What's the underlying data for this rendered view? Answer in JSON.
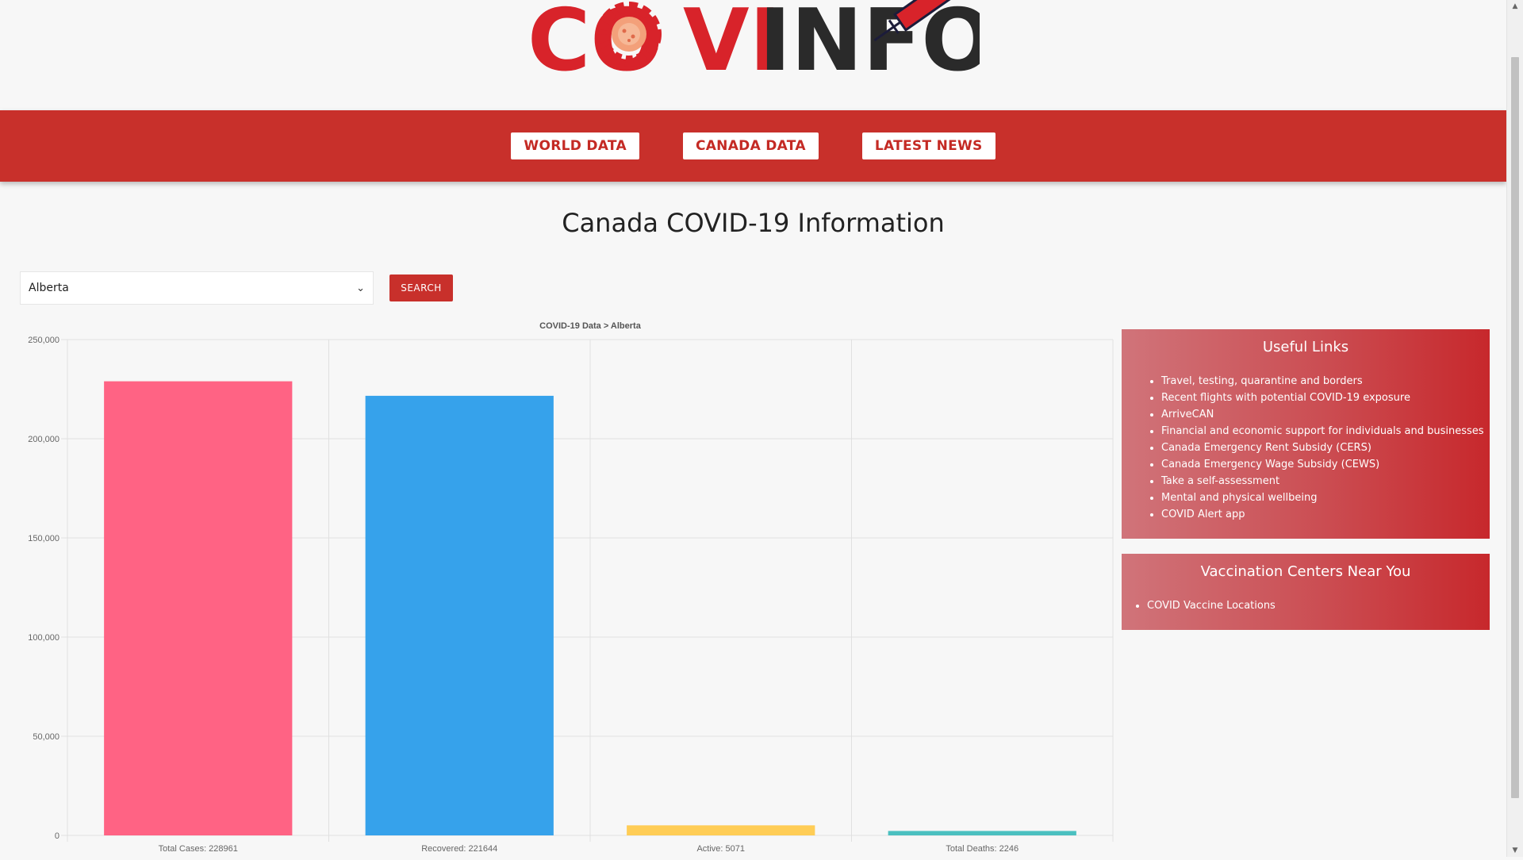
{
  "logo": {
    "text_left": "CO",
    "text_mid": "VI",
    "text_right": "INFO",
    "brand_red": "#d8232a",
    "brand_dark": "#2a2a2a"
  },
  "nav": {
    "items": [
      {
        "label": "WORLD DATA"
      },
      {
        "label": "CANADA DATA"
      },
      {
        "label": "LATEST NEWS"
      }
    ]
  },
  "page": {
    "title": "Canada COVID-19 Information"
  },
  "controls": {
    "province_selected": "Alberta",
    "search_label": "SEARCH"
  },
  "chart_data": {
    "type": "bar",
    "title": "COVID-19 Data > Alberta",
    "categories": [
      "Total Cases: 228961",
      "Recovered: 221644",
      "Active: 5071",
      "Total Deaths: 2246"
    ],
    "values": [
      228961,
      221644,
      5071,
      2246
    ],
    "colors": [
      "#ff6384",
      "#36a2eb",
      "#ffcd56",
      "#4bc0c0"
    ],
    "yticks": [
      "0",
      "50,000",
      "100,000",
      "150,000",
      "200,000",
      "250,000"
    ],
    "ylim": [
      0,
      250000
    ],
    "grid": true,
    "legend": "none"
  },
  "sidebar": {
    "useful_links": {
      "title": "Useful Links",
      "items": [
        "Travel, testing, quarantine and borders",
        "Recent flights with potential COVID-19 exposure",
        "ArriveCAN",
        "Financial and economic support for individuals and businesses",
        "Canada Emergency Rent Subsidy (CERS)",
        "Canada Emergency Wage Subsidy (CEWS)",
        "Take a self-assessment",
        "Mental and physical wellbeing",
        "COVID Alert app"
      ]
    },
    "vaccination": {
      "title": "Vaccination Centers Near You",
      "items": [
        "COVID Vaccine Locations"
      ]
    }
  }
}
